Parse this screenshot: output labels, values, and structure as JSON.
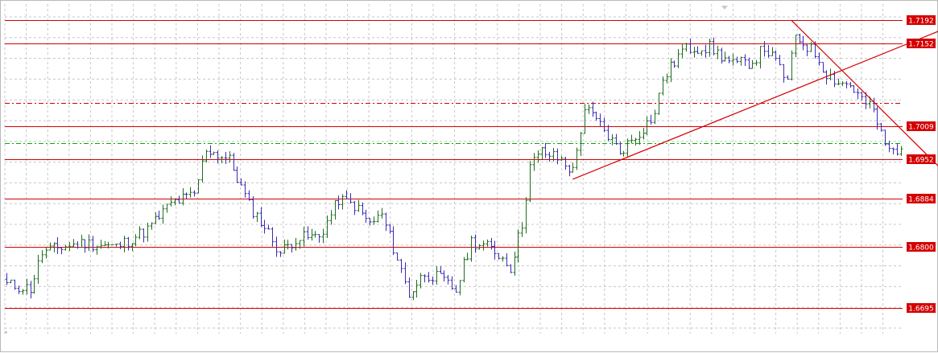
{
  "colors": {
    "background": "#ffffff",
    "grid": "#c8c8c8",
    "level_line": "#d40000",
    "dashdot_red": "#cc0000",
    "dashdot_green": "#00b000",
    "trendline": "#d40000",
    "bar_up": "#1f6d1f",
    "bar_down": "#3b2bb5",
    "tag_bg": "#d40000",
    "tag_text": "#ffffff"
  },
  "chart_data": {
    "type": "ohlc",
    "ylim": [
      1.665,
      1.722
    ],
    "grid": true,
    "price_levels": [
      {
        "label": "1.7192",
        "value": 1.7192
      },
      {
        "label": "1.7152",
        "value": 1.7152
      },
      {
        "label": "1.7009",
        "value": 1.7009
      },
      {
        "label": "1.6952",
        "value": 1.6952
      },
      {
        "label": "1.6884",
        "value": 1.6884
      },
      {
        "label": "1.6800",
        "value": 1.68
      },
      {
        "label": "1.6695",
        "value": 1.6695
      }
    ],
    "dashdot_levels": [
      {
        "value": 1.7049,
        "color": "red"
      },
      {
        "value": 1.698,
        "color": "green"
      }
    ],
    "trendlines": [
      {
        "name": "rising-trendline",
        "from": [
          145,
          1.6917
        ],
        "to": [
          253,
          1.7212
        ]
      },
      {
        "name": "falling-trendline",
        "from": [
          201,
          1.7192
        ],
        "to": [
          280,
          1.6663
        ]
      }
    ],
    "bar_count": 230,
    "close_waypoints": [
      [
        0,
        1.6735
      ],
      [
        6,
        1.6728
      ],
      [
        9,
        1.679
      ],
      [
        14,
        1.68
      ],
      [
        20,
        1.6807
      ],
      [
        28,
        1.68
      ],
      [
        36,
        1.683
      ],
      [
        42,
        1.6875
      ],
      [
        48,
        1.689
      ],
      [
        51,
        1.697
      ],
      [
        57,
        1.695
      ],
      [
        62,
        1.6872
      ],
      [
        66,
        1.6835
      ],
      [
        70,
        1.679
      ],
      [
        74,
        1.6815
      ],
      [
        80,
        1.6818
      ],
      [
        85,
        1.6882
      ],
      [
        89,
        1.6872
      ],
      [
        93,
        1.684
      ],
      [
        96,
        1.6855
      ],
      [
        100,
        1.678
      ],
      [
        103,
        1.6718
      ],
      [
        107,
        1.6755
      ],
      [
        111,
        1.6745
      ],
      [
        115,
        1.6725
      ],
      [
        119,
        1.681
      ],
      [
        123,
        1.68
      ],
      [
        126,
        1.6788
      ],
      [
        129,
        1.6765
      ],
      [
        132,
        1.684
      ],
      [
        134,
        1.694
      ],
      [
        137,
        1.6965
      ],
      [
        142,
        1.695
      ],
      [
        145,
        1.693
      ],
      [
        148,
        1.704
      ],
      [
        152,
        1.701
      ],
      [
        157,
        1.6965
      ],
      [
        162,
        1.6998
      ],
      [
        166,
        1.703
      ],
      [
        168,
        1.709
      ],
      [
        173,
        1.714
      ],
      [
        176,
        1.7145
      ],
      [
        180,
        1.7145
      ],
      [
        186,
        1.7115
      ],
      [
        191,
        1.712
      ],
      [
        194,
        1.7145
      ],
      [
        198,
        1.711
      ],
      [
        200,
        1.7085
      ],
      [
        202,
        1.7165
      ],
      [
        207,
        1.7135
      ],
      [
        210,
        1.71
      ],
      [
        213,
        1.7085
      ],
      [
        216,
        1.708
      ],
      [
        219,
        1.7055
      ],
      [
        222,
        1.7035
      ],
      [
        225,
        1.6975
      ],
      [
        227,
        1.6965
      ],
      [
        229,
        1.6975
      ]
    ],
    "annotations": []
  }
}
